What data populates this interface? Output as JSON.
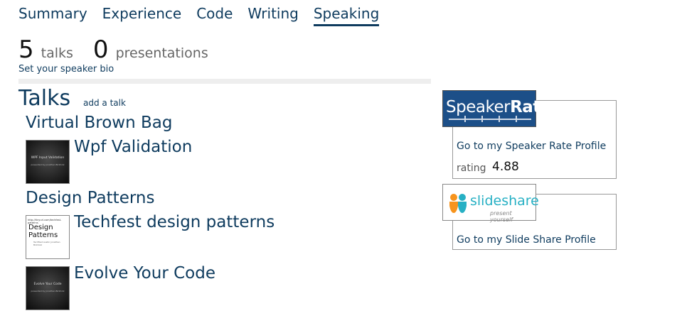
{
  "nav": {
    "summary": "Summary",
    "experience": "Experience",
    "code": "Code",
    "writing": "Writing",
    "speaking": "Speaking",
    "active": "Speaking"
  },
  "stats": {
    "talks_count": "5",
    "talks_label": "talks",
    "presentations_count": "0",
    "presentations_label": "presentations",
    "bio_link": "Set your speaker bio"
  },
  "talks": {
    "heading": "Talks",
    "add_link": "add a talk",
    "groups": [
      {
        "title": "Virtual Brown Bag",
        "items": [
          {
            "title": "Wpf Validation",
            "thumb_title": "WPF Input Validation",
            "thumb_sub": "presented by Jonathan Birkholz"
          }
        ]
      },
      {
        "title": "Design Patterns",
        "items": [
          {
            "title": "Techfest design patterns",
            "thumb_url": "http://tinyurl.com/techfest-patterns",
            "thumb_title": "Design Patterns",
            "thumb_sub": "TechFest Austin Jonathan Birkholz"
          },
          {
            "title": "Evolve Your Code",
            "thumb_title": "Evolve Your Code",
            "thumb_sub": "presented by Jonathan Birkholz"
          }
        ]
      }
    ]
  },
  "sidebar": {
    "speakerrate": {
      "logo_text_light": "Speaker",
      "logo_text_bold": "Rate",
      "link": "Go to my Speaker Rate Profile",
      "rating_label": "rating",
      "rating_value": "4.88",
      "brand_color": "#1c4f88"
    },
    "slideshare": {
      "logo_text": "slideshare",
      "logo_tagline": "present yourself",
      "link": "Go to my Slide Share Profile",
      "brand_color": "#27b0c4"
    }
  },
  "colors": {
    "accent": "#0e3b5e",
    "divider": "#eeeeee"
  }
}
